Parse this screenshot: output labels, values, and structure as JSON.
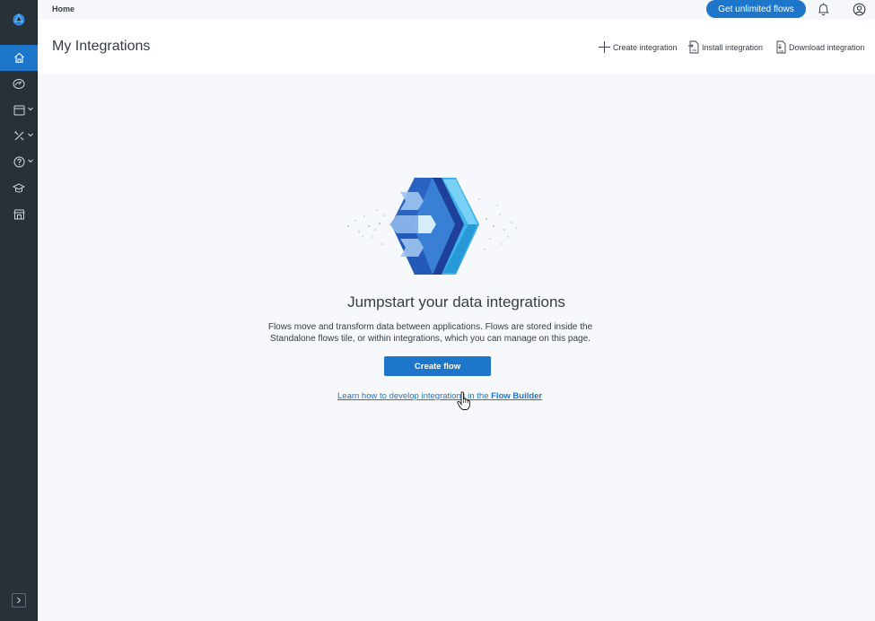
{
  "sidebar": {
    "items": [
      {
        "name": "home",
        "icon": "home-icon",
        "active": true
      },
      {
        "name": "dashboard",
        "icon": "dashboard-gauge-icon",
        "active": false
      },
      {
        "name": "resources",
        "icon": "resources-icon",
        "active": false
      },
      {
        "name": "tools",
        "icon": "tools-icon",
        "active": false
      },
      {
        "name": "help",
        "icon": "help-circle-icon",
        "active": false
      },
      {
        "name": "university",
        "icon": "graduation-cap-icon",
        "active": false
      },
      {
        "name": "marketplace",
        "icon": "storefront-icon",
        "active": false
      }
    ],
    "expand_icon": "chevron-right-icon"
  },
  "topbar": {
    "breadcrumb": "Home",
    "cta_label": "Get unlimited flows",
    "bell_icon": "bell-icon",
    "user_icon": "user-account-icon"
  },
  "header": {
    "title": "My Integrations",
    "actions": [
      {
        "label": "Create integration",
        "icon": "plus-icon"
      },
      {
        "label": "Install integration",
        "icon": "install-file-icon"
      },
      {
        "label": "Download integration",
        "icon": "download-file-icon"
      }
    ]
  },
  "empty_state": {
    "heading": "Jumpstart your data integrations",
    "description": "Flows move and transform data between applications. Flows are stored inside the Standalone flows tile, or within integrations, which you can manage on this page.",
    "button_label": "Create flow",
    "link_prefix": "Learn how to develop integrations in the ",
    "link_bold": "Flow Builder"
  },
  "colors": {
    "accent": "#1d76c9",
    "sidebar_bg": "#283038",
    "page_bg": "#f7f8fc"
  }
}
